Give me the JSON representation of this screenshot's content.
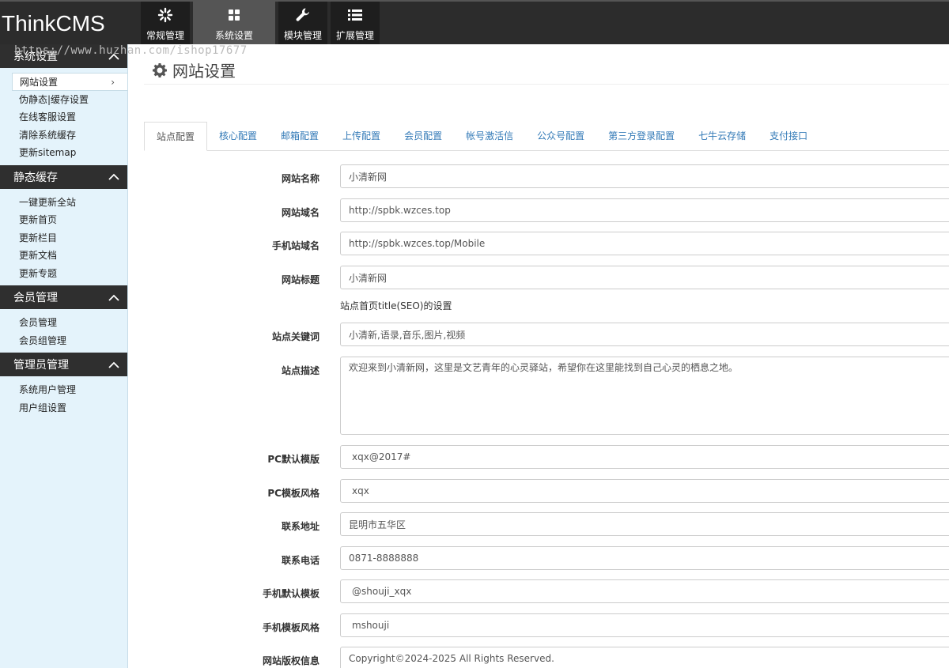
{
  "app": {
    "logo": "ThinkCMS",
    "watermark": "https://www.huzhan.com/ishop17677"
  },
  "topnav": [
    {
      "label": "常规管理",
      "icon": "asterisk-icon"
    },
    {
      "label": "系统设置",
      "icon": "grid-icon"
    },
    {
      "label": "模块管理",
      "icon": "wrench-icon"
    },
    {
      "label": "扩展管理",
      "icon": "list-icon"
    }
  ],
  "sidebar": {
    "groups": [
      {
        "title": "系统设置",
        "items": [
          "网站设置",
          "伪静态|缓存设置",
          "在线客服设置",
          "清除系统缓存",
          "更新sitemap"
        ]
      },
      {
        "title": "静态缓存",
        "items": [
          "一键更新全站",
          "更新首页",
          "更新栏目",
          "更新文档",
          "更新专题"
        ]
      },
      {
        "title": "会员管理",
        "items": [
          "会员管理",
          "会员组管理"
        ]
      },
      {
        "title": "管理员管理",
        "items": [
          "系统用户管理",
          "用户组设置"
        ]
      }
    ]
  },
  "main": {
    "title": "网站设置",
    "tabs": [
      "站点配置",
      "核心配置",
      "邮箱配置",
      "上传配置",
      "会员配置",
      "帐号激活信",
      "公众号配置",
      "第三方登录配置",
      "七牛云存储",
      "支付接口"
    ],
    "form": {
      "site_name": {
        "label": "网站名称",
        "value": "小清新网"
      },
      "site_domain": {
        "label": "网站域名",
        "value": "http://spbk.wzces.top"
      },
      "mobile_domain": {
        "label": "手机站域名",
        "value": "http://spbk.wzces.top/Mobile"
      },
      "site_title": {
        "label": "网站标题",
        "value": "小清新网",
        "help": "站点首页title(SEO)的设置"
      },
      "keywords": {
        "label": "站点关键词",
        "value": "小清新,语录,音乐,图片,视频"
      },
      "description": {
        "label": "站点描述",
        "value": "欢迎来到小清新网，这里是文艺青年的心灵驿站，希望你在这里能找到自己心灵的栖息之地。"
      },
      "pc_template": {
        "label": "PC默认模版",
        "value": "xqx@2017#"
      },
      "pc_style": {
        "label": "PC模板风格",
        "value": "xqx"
      },
      "address": {
        "label": "联系地址",
        "value": "昆明市五华区"
      },
      "phone": {
        "label": "联系电话",
        "value": "0871-8888888"
      },
      "mobile_template": {
        "label": "手机默认模板",
        "value": "@shouji_xqx"
      },
      "mobile_style": {
        "label": "手机模板风格",
        "value": "mshouji"
      },
      "copyright": {
        "label": "网站版权信息",
        "value": "Copyright©2024-2025 All Rights Reserved."
      }
    }
  },
  "colors": {
    "topbar": "#2c2c2c",
    "sidebar_bg": "#e4f3fb",
    "group_head": "#2f2f2f",
    "tab_link": "#337ab7"
  }
}
